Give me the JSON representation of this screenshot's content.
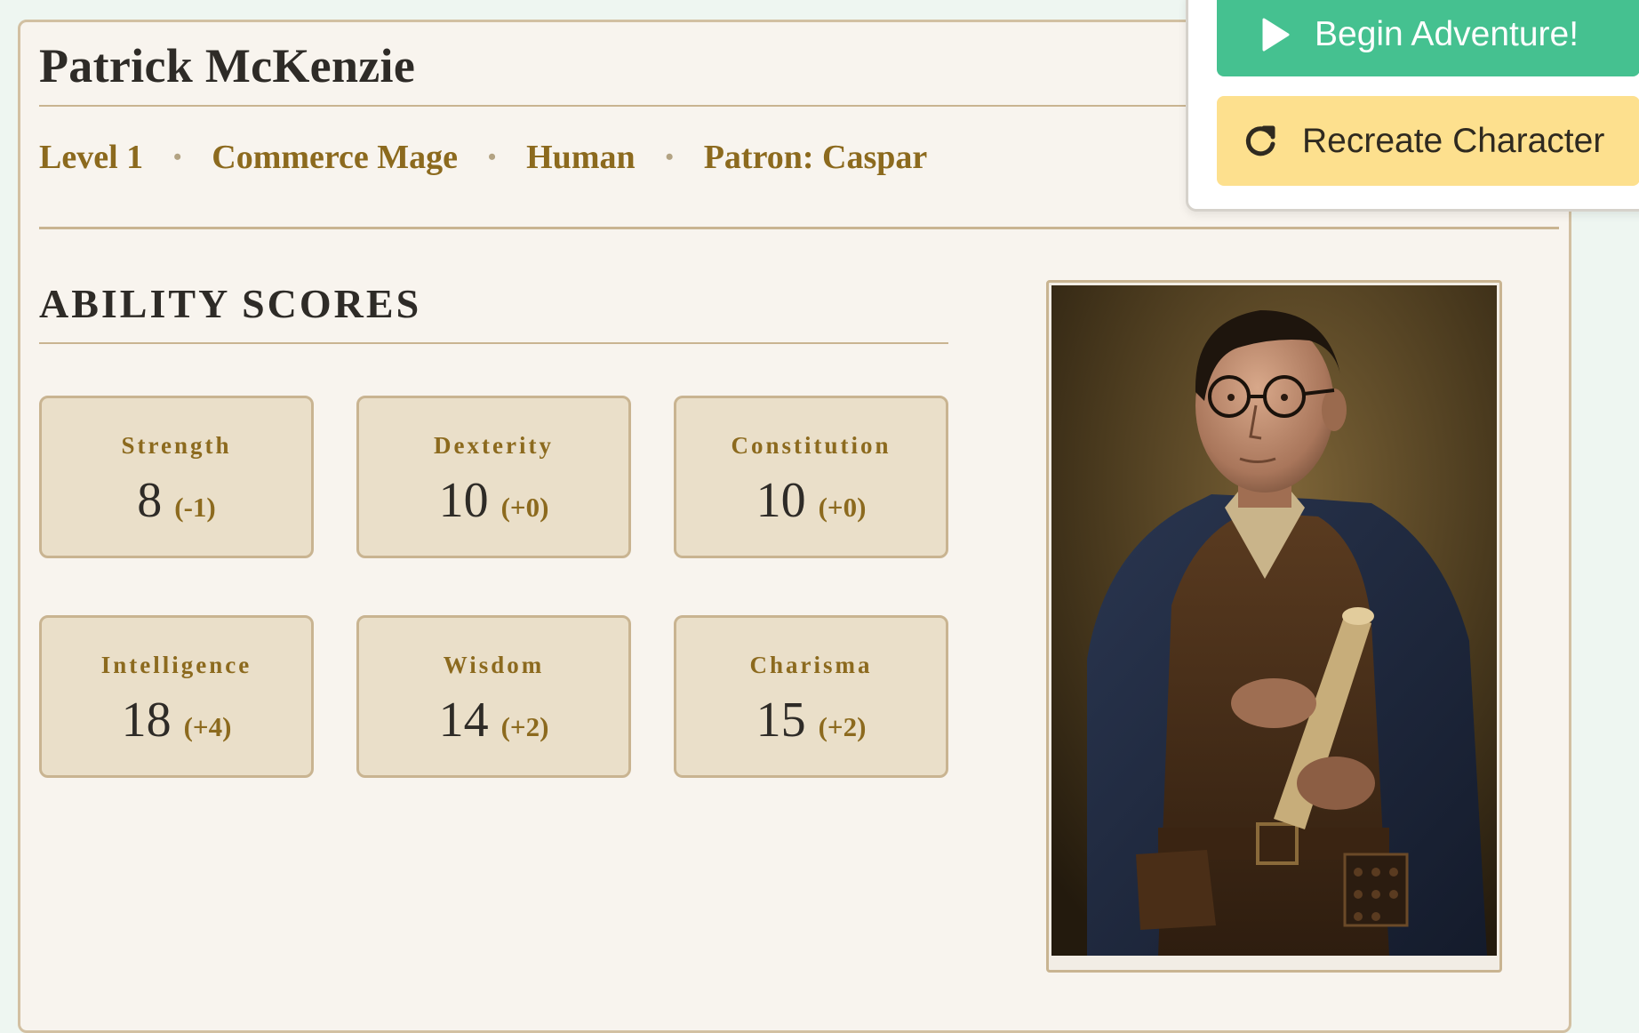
{
  "character": {
    "name": "Patrick McKenzie",
    "meta": {
      "level": "Level 1",
      "class": "Commerce Mage",
      "race": "Human",
      "patron": "Patron: Caspar",
      "separator": "•"
    }
  },
  "abilities": {
    "title": "ABILITY SCORES",
    "items": [
      {
        "name": "Strength",
        "score": "8",
        "modifier": "(-1)"
      },
      {
        "name": "Dexterity",
        "score": "10",
        "modifier": "(+0)"
      },
      {
        "name": "Constitution",
        "score": "10",
        "modifier": "(+0)"
      },
      {
        "name": "Intelligence",
        "score": "18",
        "modifier": "(+4)"
      },
      {
        "name": "Wisdom",
        "score": "14",
        "modifier": "(+2)"
      },
      {
        "name": "Charisma",
        "score": "15",
        "modifier": "(+2)"
      }
    ]
  },
  "portrait": {
    "icon": "character-portrait"
  },
  "actions": {
    "begin_label": "Begin Adventure!",
    "begin_icon": "play-icon",
    "recreate_label": "Recreate Character",
    "recreate_icon": "refresh-icon"
  },
  "colors": {
    "accent_gold": "#8c6a1e",
    "begin_green": "#45c190",
    "recreate_yellow": "#fde08e",
    "card_bg": "#eadfc9",
    "sheet_bg": "#f8f4ee"
  }
}
